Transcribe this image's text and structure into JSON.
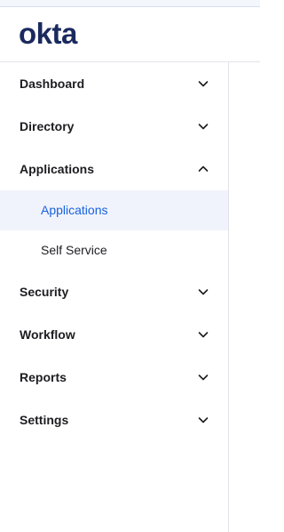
{
  "brand": {
    "logo_text": "okta"
  },
  "sidebar": {
    "items": [
      {
        "label": "Dashboard",
        "expanded": false
      },
      {
        "label": "Directory",
        "expanded": false
      },
      {
        "label": "Applications",
        "expanded": true,
        "children": [
          {
            "label": "Applications",
            "active": true
          },
          {
            "label": "Self Service",
            "active": false
          }
        ]
      },
      {
        "label": "Security",
        "expanded": false
      },
      {
        "label": "Workflow",
        "expanded": false
      },
      {
        "label": "Reports",
        "expanded": false
      },
      {
        "label": "Settings",
        "expanded": false
      }
    ]
  },
  "colors": {
    "brand_navy": "#1b2a5e",
    "active_link": "#1662dd",
    "active_bg": "#f1f3fc"
  },
  "icons": {
    "collapsed": "chevron-down-icon",
    "expanded": "chevron-up-icon"
  }
}
